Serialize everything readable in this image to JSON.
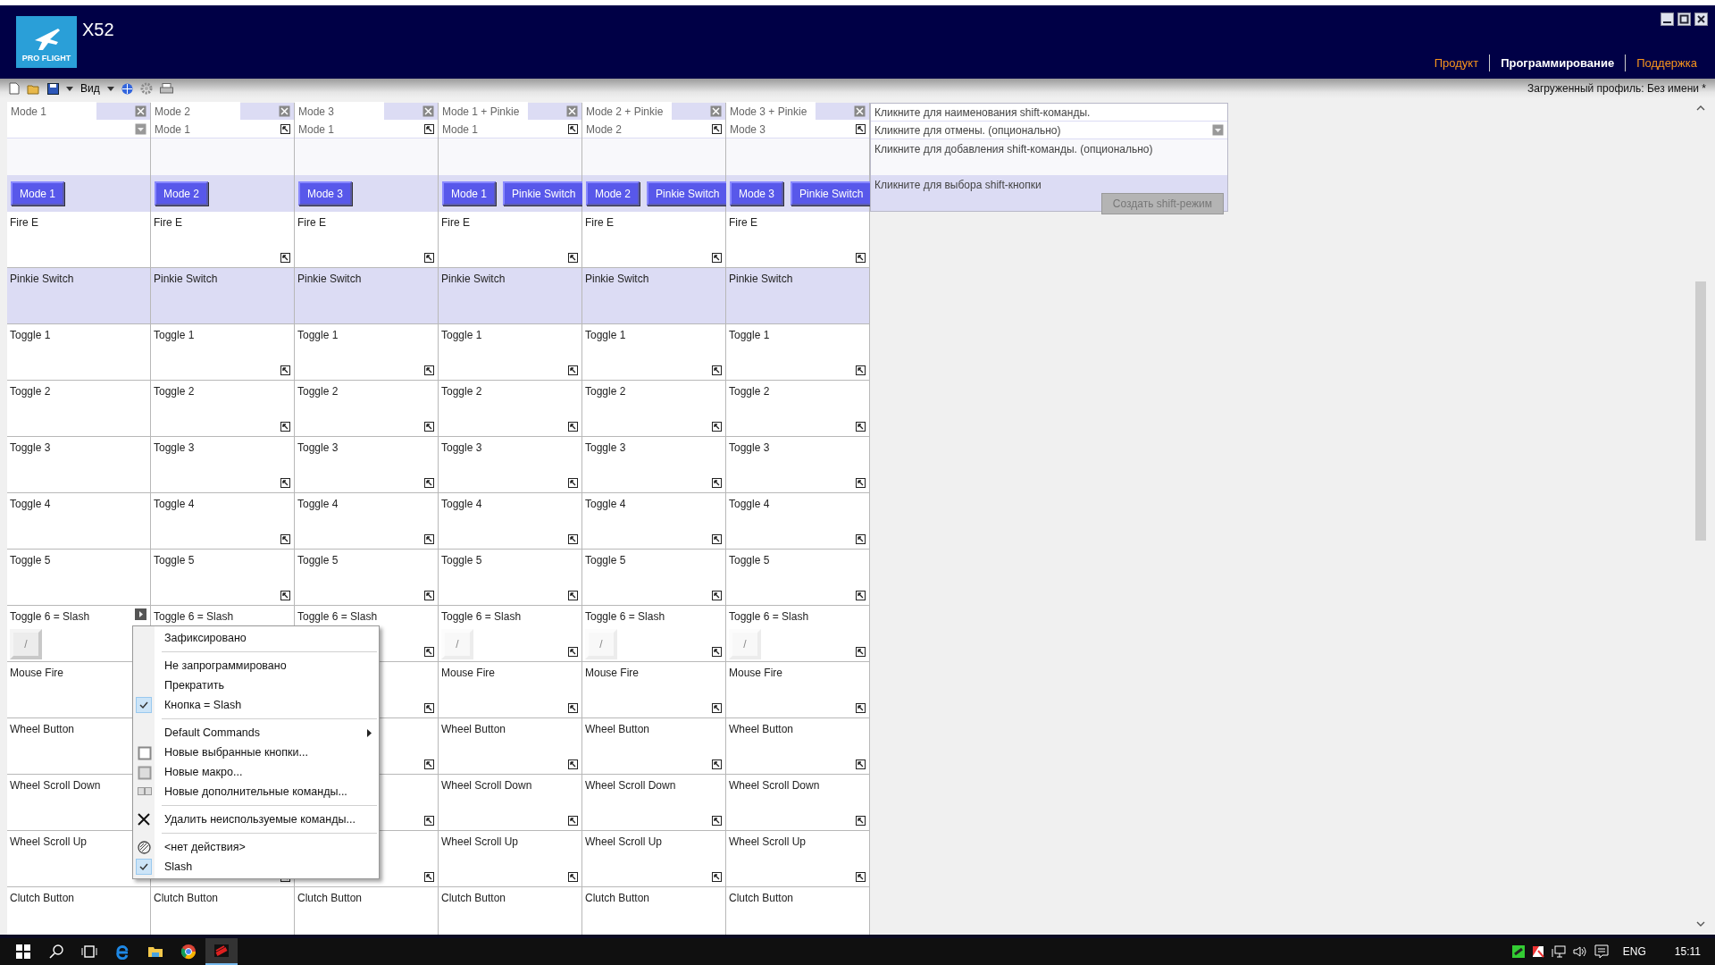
{
  "app": {
    "title": "X52",
    "logo_text": "PRO FLIGHT"
  },
  "nav": [
    {
      "label": "Продукт",
      "selected": false
    },
    {
      "label": "Программирование",
      "selected": true
    },
    {
      "label": "Поддержка",
      "selected": false
    }
  ],
  "toolbar": {
    "view_label": "Вид",
    "profile": "Загруженный профиль: Без имени *"
  },
  "columns": [
    {
      "name": "Mode 1",
      "kind": "dropdown",
      "buttons": [
        "Mode 1"
      ]
    },
    {
      "name": "Mode 2",
      "source": "Mode 1",
      "kind": "link",
      "buttons": [
        "Mode 2"
      ]
    },
    {
      "name": "Mode 3",
      "source": "Mode 1",
      "kind": "link",
      "buttons": [
        "Mode 3"
      ]
    },
    {
      "name": "Mode 1 + Pinkie",
      "source": "Mode 1",
      "kind": "link",
      "buttons": [
        "Mode 1",
        "Pinkie Switch"
      ]
    },
    {
      "name": "Mode 2 + Pinkie",
      "source": "Mode 2",
      "kind": "link",
      "buttons": [
        "Mode 2",
        "Pinkie Switch"
      ]
    },
    {
      "name": "Mode 3 + Pinkie",
      "source": "Mode 3",
      "kind": "link",
      "buttons": [
        "Mode 3",
        "Pinkie Switch"
      ]
    }
  ],
  "shift_panel": {
    "name_hint": "Кликните для наименования shift-команды.",
    "cancel_hint": "Кликните для отмены. (опционально)",
    "add_hint": "Кликните для добавления shift-команды. (опционально)",
    "button_hint": "Кликните для выбора shift-кнопки",
    "create_button": "Создать shift-режим",
    "create_disabled": true
  },
  "rows": [
    {
      "shaded": false,
      "cells": [
        {
          "label": "Fire E",
          "linked": false
        },
        {
          "label": "Fire E",
          "linked": true
        },
        {
          "label": "Fire E",
          "linked": true
        },
        {
          "label": "Fire E",
          "linked": true
        },
        {
          "label": "Fire E",
          "linked": true
        },
        {
          "label": "Fire E",
          "linked": true
        }
      ]
    },
    {
      "shaded": true,
      "cells": [
        {
          "label": "Pinkie Switch",
          "linked": false
        },
        {
          "label": "Pinkie Switch",
          "linked": false
        },
        {
          "label": "Pinkie Switch",
          "linked": false
        },
        {
          "label": "Pinkie Switch",
          "linked": false
        },
        {
          "label": "Pinkie Switch",
          "linked": false
        },
        {
          "label": "Pinkie Switch",
          "linked": false
        }
      ]
    },
    {
      "shaded": false,
      "cells": [
        {
          "label": "Toggle 1",
          "linked": false
        },
        {
          "label": "Toggle 1",
          "linked": true
        },
        {
          "label": "Toggle 1",
          "linked": true
        },
        {
          "label": "Toggle 1",
          "linked": true
        },
        {
          "label": "Toggle 1",
          "linked": true
        },
        {
          "label": "Toggle 1",
          "linked": true
        }
      ]
    },
    {
      "shaded": false,
      "cells": [
        {
          "label": "Toggle 2",
          "linked": false
        },
        {
          "label": "Toggle 2",
          "linked": true
        },
        {
          "label": "Toggle 2",
          "linked": true
        },
        {
          "label": "Toggle 2",
          "linked": true
        },
        {
          "label": "Toggle 2",
          "linked": true
        },
        {
          "label": "Toggle 2",
          "linked": true
        }
      ]
    },
    {
      "shaded": false,
      "cells": [
        {
          "label": "Toggle 3",
          "linked": false
        },
        {
          "label": "Toggle 3",
          "linked": true
        },
        {
          "label": "Toggle 3",
          "linked": true
        },
        {
          "label": "Toggle 3",
          "linked": true
        },
        {
          "label": "Toggle 3",
          "linked": true
        },
        {
          "label": "Toggle 3",
          "linked": true
        }
      ]
    },
    {
      "shaded": false,
      "cells": [
        {
          "label": "Toggle 4",
          "linked": false
        },
        {
          "label": "Toggle 4",
          "linked": true
        },
        {
          "label": "Toggle 4",
          "linked": true
        },
        {
          "label": "Toggle 4",
          "linked": true
        },
        {
          "label": "Toggle 4",
          "linked": true
        },
        {
          "label": "Toggle 4",
          "linked": true
        }
      ]
    },
    {
      "shaded": false,
      "cells": [
        {
          "label": "Toggle 5",
          "linked": false
        },
        {
          "label": "Toggle 5",
          "linked": true
        },
        {
          "label": "Toggle 5",
          "linked": true
        },
        {
          "label": "Toggle 5",
          "linked": true
        },
        {
          "label": "Toggle 5",
          "linked": true
        },
        {
          "label": "Toggle 5",
          "linked": true
        }
      ]
    },
    {
      "shaded": false,
      "cells": [
        {
          "label": "Toggle 6 = Slash",
          "linked": false,
          "key": "/",
          "key_active": true,
          "menu_open": true
        },
        {
          "label": "Toggle 6 = Slash",
          "menu_open": false
        },
        {
          "label": "Toggle 6 = Slash",
          "linked": true,
          "menu_open": false
        },
        {
          "label": "Toggle 6 = Slash",
          "linked": true,
          "key": "/",
          "key_active": false,
          "menu_open": false
        },
        {
          "label": "Toggle 6 = Slash",
          "linked": true,
          "key": "/",
          "key_active": false,
          "menu_open": false
        },
        {
          "label": "Toggle 6 = Slash",
          "linked": true,
          "key": "/",
          "key_active": false,
          "menu_open": false
        }
      ]
    },
    {
      "shaded": false,
      "cells": [
        {
          "label": "Mouse Fire"
        },
        {},
        {
          "linked": true
        },
        {
          "label": "Mouse Fire",
          "linked": true
        },
        {
          "label": "Mouse Fire",
          "linked": true
        },
        {
          "label": "Mouse Fire",
          "linked": true
        }
      ]
    },
    {
      "shaded": false,
      "cells": [
        {
          "label": "Wheel Button"
        },
        {},
        {
          "linked": true
        },
        {
          "label": "Wheel Button",
          "linked": true
        },
        {
          "label": "Wheel Button",
          "linked": true
        },
        {
          "label": "Wheel Button",
          "linked": true
        }
      ]
    },
    {
      "shaded": false,
      "cells": [
        {
          "label": "Wheel Scroll Down"
        },
        {},
        {
          "linked": true
        },
        {
          "label": "Wheel Scroll Down",
          "linked": true
        },
        {
          "label": "Wheel Scroll Down",
          "linked": true
        },
        {
          "label": "Wheel Scroll Down",
          "linked": true
        }
      ]
    },
    {
      "shaded": false,
      "cells": [
        {
          "label": "Wheel Scroll Up",
          "linked": false
        },
        {
          "linked": true
        },
        {
          "linked": true
        },
        {
          "label": "Wheel Scroll Up",
          "linked": true
        },
        {
          "label": "Wheel Scroll Up",
          "linked": true
        },
        {
          "label": "Wheel Scroll Up",
          "linked": true
        }
      ]
    },
    {
      "shaded": false,
      "cells": [
        {
          "label": "Clutch Button",
          "linked": false
        },
        {
          "label": "Clutch Button",
          "linked": false
        },
        {
          "label": "Clutch Button",
          "linked": false
        },
        {
          "label": "Clutch Button",
          "linked": false
        },
        {
          "label": "Clutch Button",
          "linked": false
        },
        {
          "label": "Clutch Button",
          "linked": false
        }
      ]
    }
  ],
  "context_menu": [
    {
      "kind": "text",
      "label": "Зафиксировано",
      "checked": false
    },
    {
      "kind": "separator"
    },
    {
      "kind": "text",
      "label": "Не запрограммировано",
      "checked": false
    },
    {
      "kind": "text",
      "label": "Прекратить",
      "checked": false
    },
    {
      "kind": "text",
      "label": "Кнопка = Slash",
      "checked": true
    },
    {
      "kind": "separator"
    },
    {
      "kind": "submenu",
      "label": "Default Commands",
      "checked": false
    },
    {
      "kind": "new-buttons",
      "label": "Новые выбранные кнопки...",
      "checked": false
    },
    {
      "kind": "new-macro",
      "label": "Новые макро...",
      "checked": false
    },
    {
      "kind": "new-advanced",
      "label": "Новые дополнительные команды...",
      "checked": false
    },
    {
      "kind": "separator"
    },
    {
      "kind": "delete",
      "label": "Удалить неиспользуемые команды...",
      "checked": false
    },
    {
      "kind": "separator"
    },
    {
      "kind": "no-action",
      "label": "<нет  действия>",
      "checked": false
    },
    {
      "kind": "text",
      "label": "Slash",
      "checked": true
    }
  ],
  "taskbar": {
    "language": "ENG",
    "time": "15:11"
  }
}
